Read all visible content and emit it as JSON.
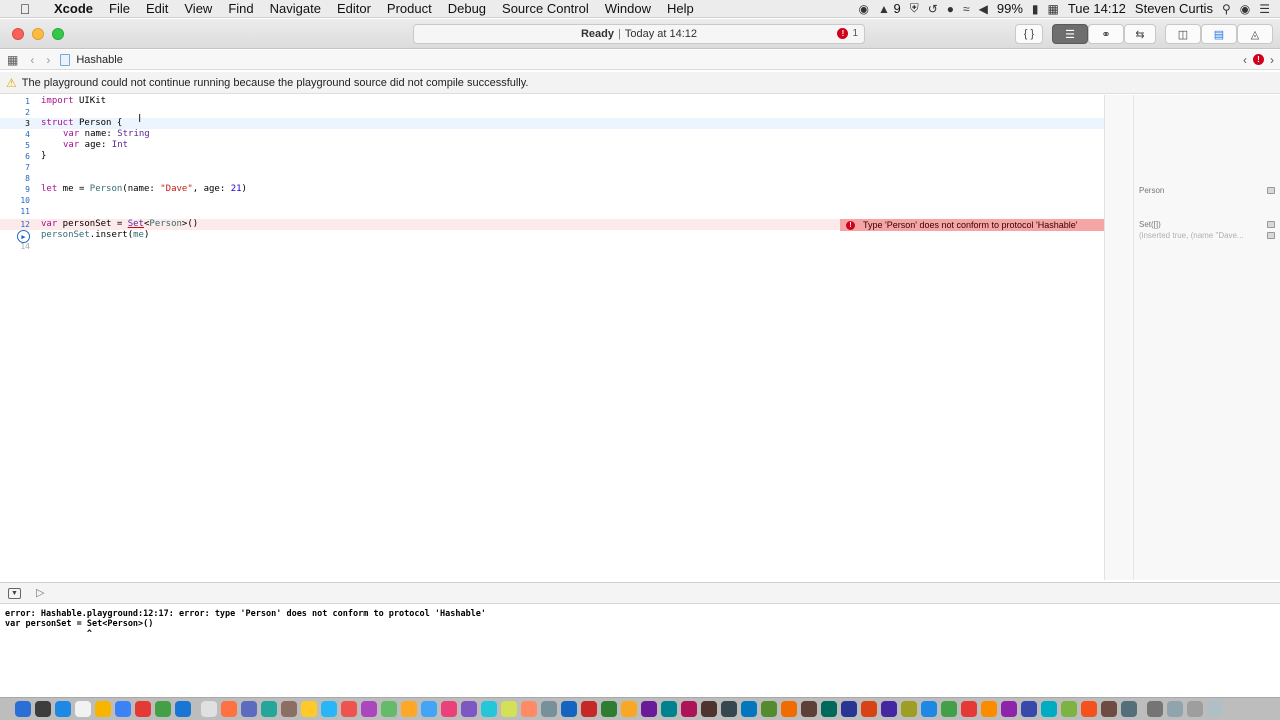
{
  "menubar": {
    "app_name": "Xcode",
    "items": [
      "File",
      "Edit",
      "View",
      "Find",
      "Navigate",
      "Editor",
      "Product",
      "Debug",
      "Source Control",
      "Window",
      "Help"
    ],
    "status": {
      "notification_count": "9",
      "battery": "99%",
      "clock": "Tue 14:12",
      "user": "Steven Curtis"
    }
  },
  "window": {
    "activity_status": "Ready",
    "activity_time": "Today at 14:12",
    "error_count": "1"
  },
  "jumpbar": {
    "file_name": "Hashable"
  },
  "banner": {
    "message": "The playground could not continue running because the playground source did not compile successfully."
  },
  "editor": {
    "lines": [
      {
        "n": "1"
      },
      {
        "n": "2"
      },
      {
        "n": "3"
      },
      {
        "n": "4"
      },
      {
        "n": "5"
      },
      {
        "n": "6"
      },
      {
        "n": "7"
      },
      {
        "n": "8"
      },
      {
        "n": "9"
      },
      {
        "n": "10"
      },
      {
        "n": "11"
      },
      {
        "n": "12"
      },
      {
        "n": "13"
      },
      {
        "n": "14"
      }
    ],
    "tokens": {
      "import_kw": "import",
      "uikit": "UIKit",
      "struct_kw": "struct",
      "person_name": "Person",
      "open_brace": " {",
      "var_kw": "var",
      "name_decl": " name: ",
      "string_type": "String",
      "age_decl": " age: ",
      "int_type": "Int",
      "close_brace": "}",
      "let_kw": "let",
      "me_decl": " me = ",
      "person_type": "Person",
      "init_open": "(name: ",
      "dave": "\"Dave\"",
      "age_arg": ", age: ",
      "age_value": "21",
      "init_close": ")",
      "personset_decl": " personSet = ",
      "set_type": "Set",
      "generic_open": "<",
      "generic_type": "Person",
      "generic_close": ">()",
      "personset_ref": "personSet",
      "insert_call": ".insert(",
      "me_ref": "me",
      "insert_close": ")"
    },
    "error_message": "Type 'Person' does not conform to protocol 'Hashable'"
  },
  "results": {
    "line9": "Person",
    "line12": "Set([])",
    "line13": "(inserted true, (name \"Dave..."
  },
  "console": {
    "line1": "error: Hashable.playground:12:17: error: type 'Person' does not conform to protocol 'Hashable'",
    "line2": "var personSet = Set<Person>()",
    "line3": "                ^"
  },
  "dock": {
    "icon_colors": [
      "#2a6fd6",
      "#3d3d3d",
      "#1e88e5",
      "#f2f2f2",
      "#f7b500",
      "#3b82f6",
      "#e53935",
      "#43a047",
      "#1976d2",
      "#e0e0e0",
      "#ff7043",
      "#5c6bc0",
      "#26a69a",
      "#8d6e63",
      "#ffca28",
      "#29b6f6",
      "#ef5350",
      "#ab47bc",
      "#66bb6a",
      "#ffa726",
      "#42a5f5",
      "#ec407a",
      "#7e57c2",
      "#26c6da",
      "#d4e157",
      "#ff8a65",
      "#78909c",
      "#1565c0",
      "#c62828",
      "#2e7d32",
      "#f9a825",
      "#6a1b9a",
      "#00838f",
      "#ad1457",
      "#4e342e",
      "#37474f",
      "#0277bd",
      "#558b2f",
      "#ef6c00",
      "#5d4037",
      "#00695c",
      "#283593",
      "#d84315",
      "#4527a0",
      "#9e9d24",
      "#1e88e5",
      "#43a047",
      "#e53935",
      "#fb8c00",
      "#8e24aa",
      "#3949ab",
      "#00acc1",
      "#7cb342",
      "#f4511e",
      "#6d4c41",
      "#546e7a",
      "#757575",
      "#90a4ae",
      "#9e9e9e",
      "#b0bec5"
    ]
  }
}
